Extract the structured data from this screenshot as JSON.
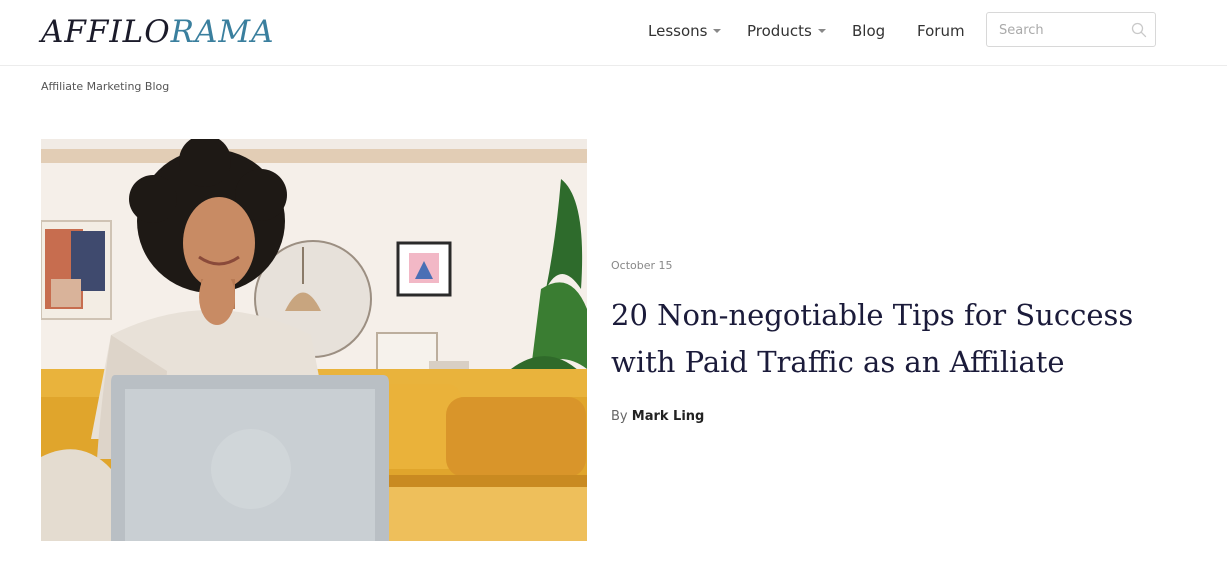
{
  "header": {
    "logo": {
      "part1": "AFFILO",
      "part2": "RAMA"
    },
    "nav": [
      {
        "label": "Lessons",
        "has_dropdown": true
      },
      {
        "label": "Products",
        "has_dropdown": true
      },
      {
        "label": "Blog",
        "has_dropdown": false
      },
      {
        "label": "Forum",
        "has_dropdown": false
      }
    ],
    "search": {
      "placeholder": "Search",
      "icon": "search-icon"
    }
  },
  "breadcrumb": "Affiliate Marketing Blog",
  "article": {
    "date": "October 15",
    "title": "20 Non-negotiable Tips for Success with Paid Traffic as an Affiliate",
    "byline_prefix": "By",
    "author": "Mark Ling"
  },
  "colors": {
    "logo_dark": "#1b1b2a",
    "logo_accent": "#3a7f9e",
    "title": "#1b1b3a",
    "sofa": "#e0a52c",
    "background": "#ffffff"
  }
}
